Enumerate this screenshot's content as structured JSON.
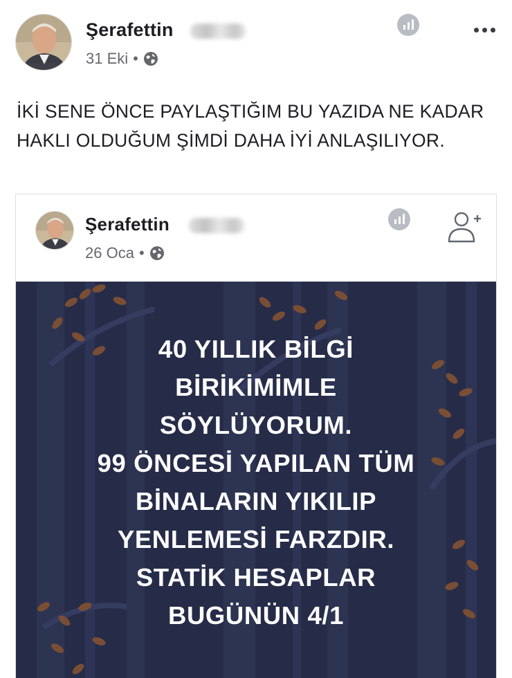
{
  "post": {
    "author": "Şerafettin",
    "date": "31 Eki",
    "separator": "•",
    "text": "İKİ SENE ÖNCE PAYLAŞTIĞIM BU YAZIDA NE KADAR HAKLI OLDUĞUM ŞİMDİ DAHA İYİ ANLAŞILIYOR."
  },
  "shared": {
    "author": "Şerafettin",
    "date": "26 Oca",
    "separator": "•",
    "image_text": "40 YILLIK BİLGİ\nBİRİKİMİMLE\nSÖYLÜYORUM.\n99 ÖNCESİ YAPILAN TÜM\nBİNALARIN YIKILIP\nYENLEMESİ FARZDIR.\nSTATİK HESAPLAR\nBUGÜNÜN  4/1"
  },
  "icons": {
    "privacy": "globe-icon",
    "insights": "stats-icon",
    "menu": "more-icon",
    "add_friend": "add-friend-icon"
  },
  "colors": {
    "text": "#1c1e21",
    "meta": "#65676b",
    "image_background": "#262c48",
    "image_text": "#ffffff",
    "leaf_accent": "#8a5a3a"
  }
}
